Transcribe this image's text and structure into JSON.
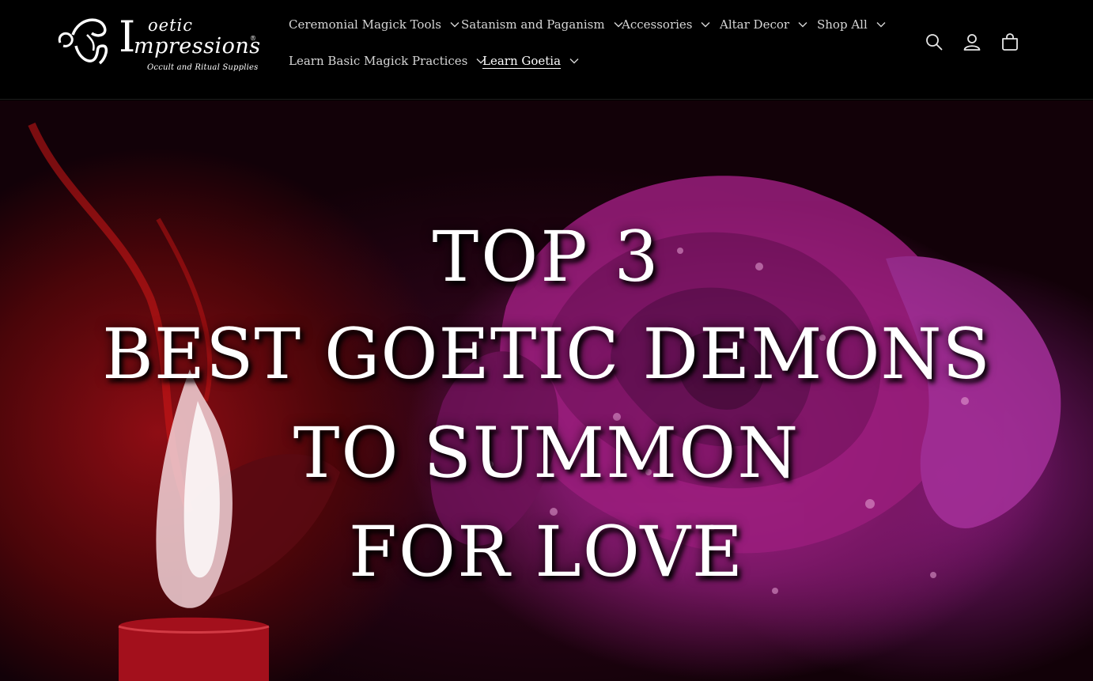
{
  "brand": {
    "name_small": "oetic",
    "name_i": "I",
    "name_main": "mpressions",
    "registered": "®",
    "tagline": "Occult and Ritual Supplies"
  },
  "nav": {
    "row1": [
      {
        "label": "Ceremonial Magick Tools",
        "dropdown": true
      },
      {
        "label": "Satanism and Paganism",
        "dropdown": true
      },
      {
        "label": "Accessories",
        "dropdown": true
      },
      {
        "label": "Altar Decor",
        "dropdown": true
      },
      {
        "label": "Shop All",
        "dropdown": true
      }
    ],
    "row2": [
      {
        "label": "Learn Basic Magick Practices",
        "dropdown": true
      },
      {
        "label": "Learn Goetia",
        "dropdown": true,
        "active": true
      }
    ]
  },
  "header_icons": [
    "search-icon",
    "account-icon",
    "cart-icon"
  ],
  "hero": {
    "line1": "TOP 3",
    "line2": "BEST GOETIC DEMONS",
    "line3": "TO SUMMON",
    "line4": "FOR LOVE"
  },
  "colors": {
    "header_bg": "#000000",
    "nav_text": "#d6d6d6",
    "hero_rose": "#b0238e",
    "hero_candle": "#8e0d14"
  }
}
